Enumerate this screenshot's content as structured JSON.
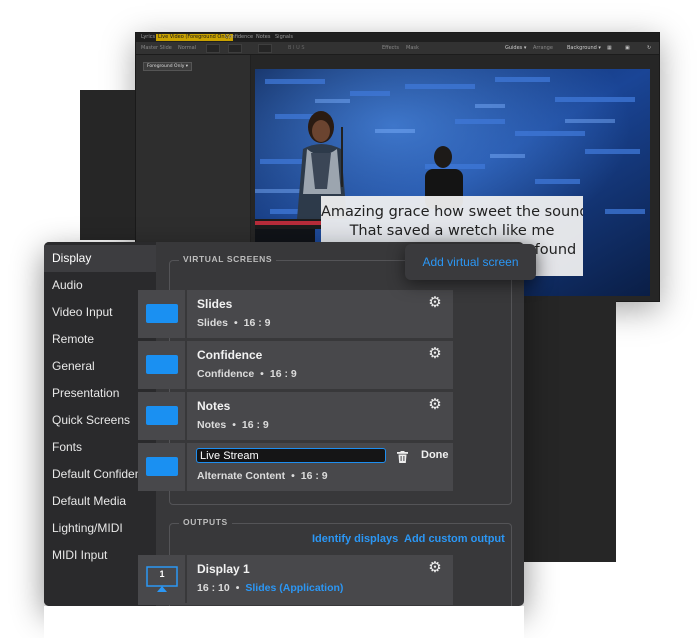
{
  "editor": {
    "tabs": [
      "Lyrics",
      "Live Video (Foreground Only)",
      "Confidence",
      "Notes",
      "Signals"
    ],
    "toolbar_left": [
      "Master Slide",
      "Normal"
    ],
    "toolbar_mid": [
      "Effects",
      "Mask"
    ],
    "toolbar_right": [
      "Guides ▾",
      "Arrange",
      "Background ▾"
    ],
    "layer_dropdown": "Foreground Only ▾"
  },
  "lyrics": {
    "line1": "Amazing grace how sweet the sound",
    "line2": "That saved a wretch like me",
    "line3": "I once was lost, but now I'm found"
  },
  "tooltip": {
    "label": "Add virtual screen"
  },
  "settings": {
    "sidebar": {
      "items": [
        "Display",
        "Audio",
        "Video Input",
        "Remote",
        "General",
        "Presentation",
        "Quick Screens",
        "Fonts",
        "Default Confidence",
        "Default Media",
        "Lighting/MIDI",
        "MIDI Input"
      ],
      "active": "Display"
    },
    "virtual_screens": {
      "heading": "VIRTUAL SCREENS",
      "rows": [
        {
          "name": "Slides",
          "content": "Slides",
          "aspect": "16 : 9"
        },
        {
          "name": "Confidence",
          "content": "Confidence",
          "aspect": "16 : 9"
        },
        {
          "name": "Notes",
          "content": "Notes",
          "aspect": "16 : 9"
        },
        {
          "name": "Live Stream",
          "content": "Alternate Content",
          "aspect": "16 : 9",
          "editing": true,
          "done_label": "Done"
        }
      ]
    },
    "outputs": {
      "heading": "OUTPUTS",
      "identify_label": "Identify displays",
      "add_custom_label": "Add custom output",
      "display": {
        "title": "Display 1",
        "number": "1",
        "aspect": "16 : 10",
        "assignment": "Slides (Application)"
      }
    },
    "separator": "•"
  },
  "colors": {
    "accent": "#2b97f5",
    "thumb": "#1a90f2"
  }
}
